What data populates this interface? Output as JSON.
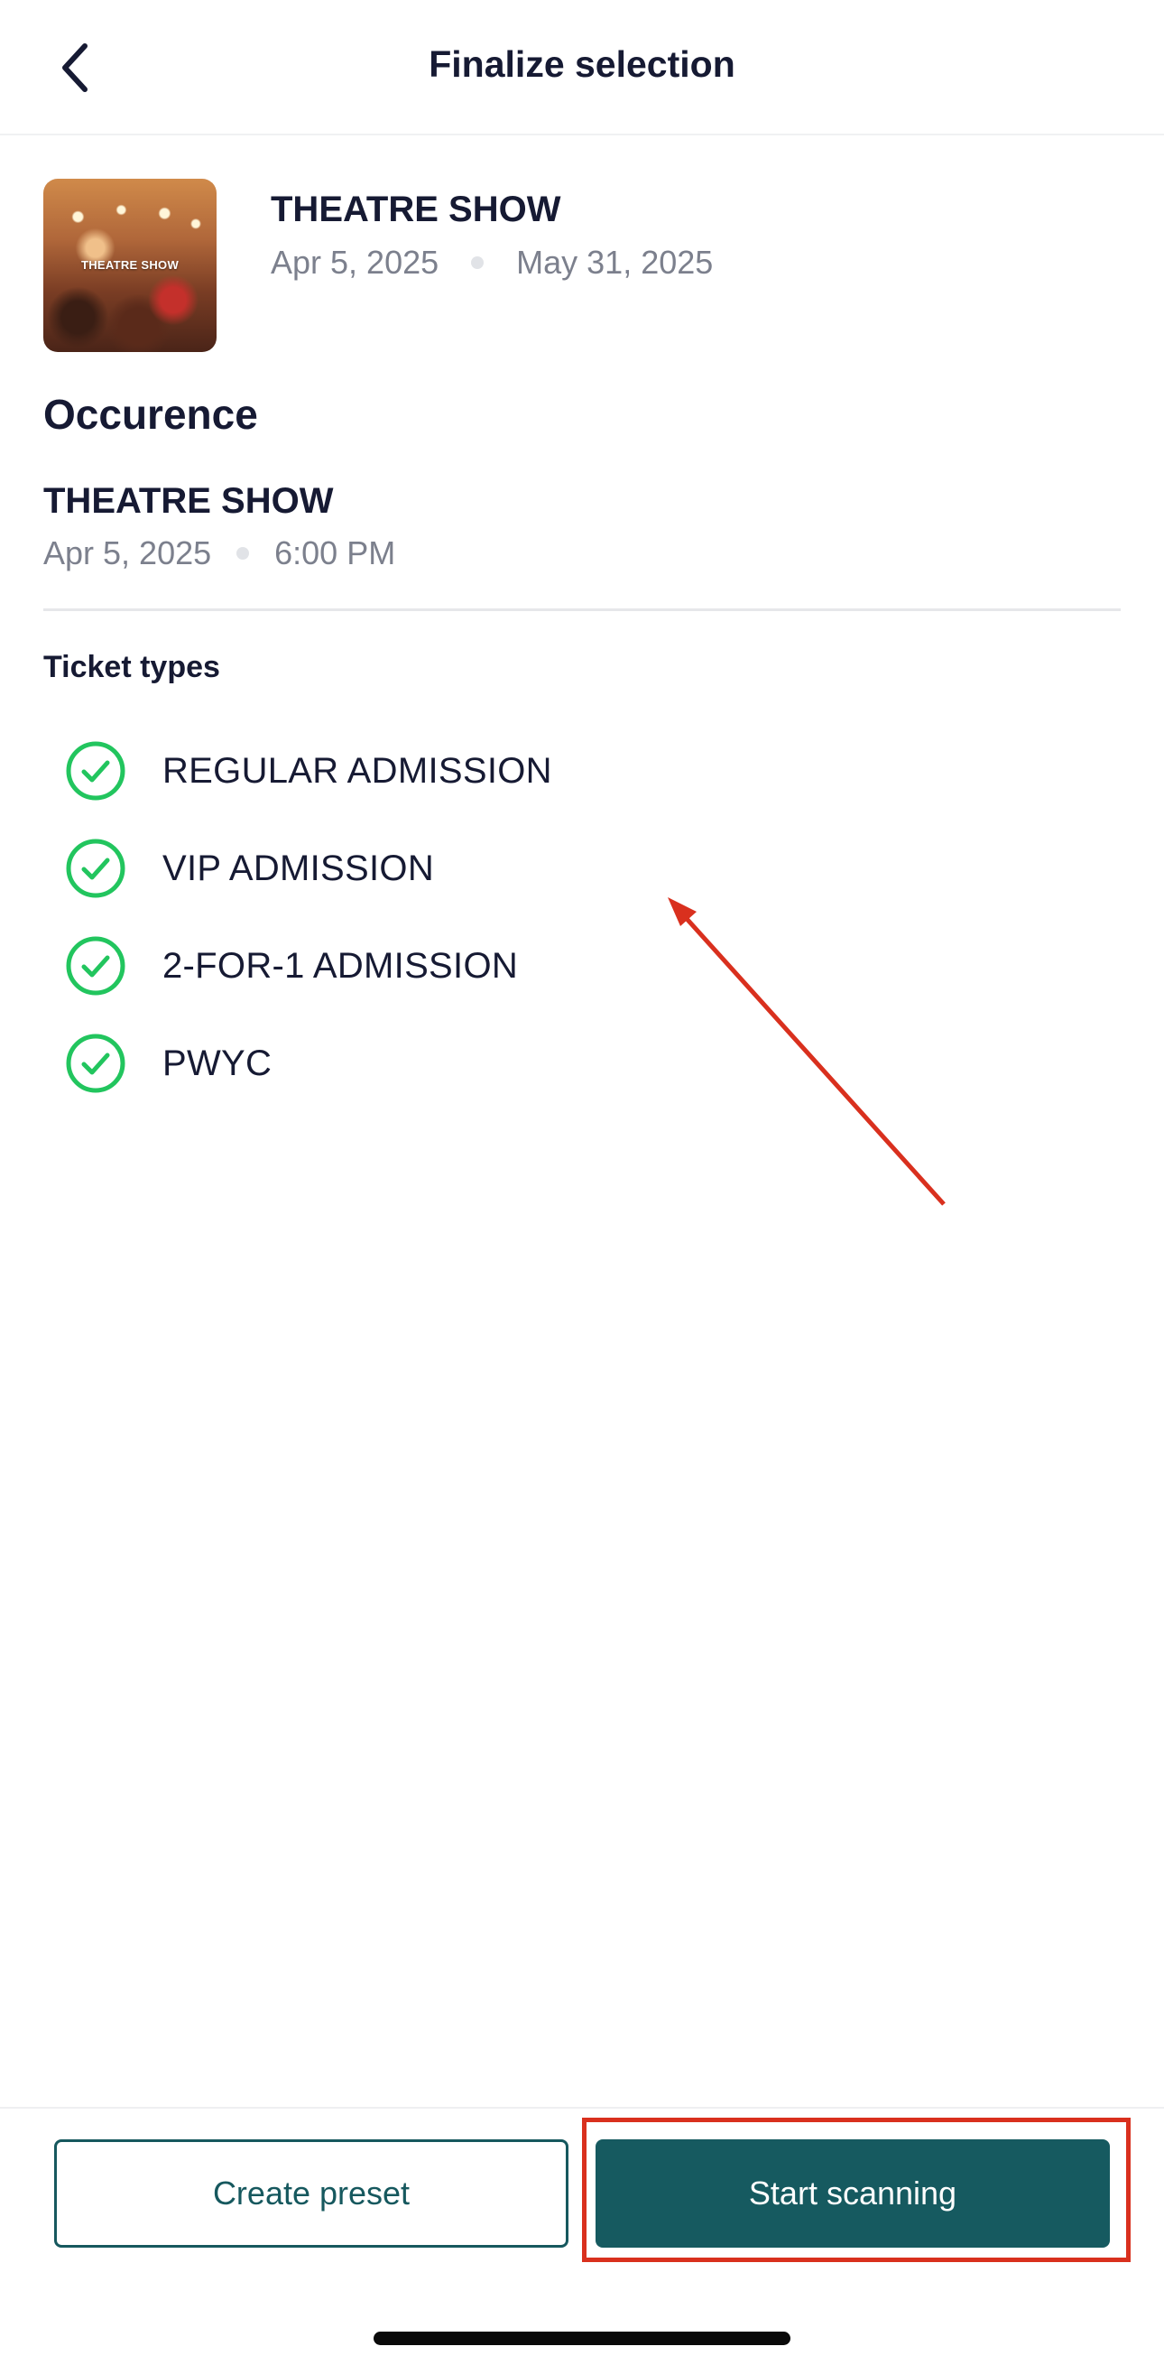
{
  "header": {
    "title": "Finalize selection"
  },
  "event": {
    "thumbnail_text": "THEATRE SHOW",
    "name": "THEATRE SHOW",
    "start_date": "Apr 5, 2025",
    "end_date": "May 31, 2025"
  },
  "occurrence": {
    "heading": "Occurence",
    "name": "THEATRE SHOW",
    "date": "Apr 5, 2025",
    "time": "6:00 PM"
  },
  "ticket_types": {
    "heading": "Ticket types",
    "items": [
      {
        "label": "REGULAR ADMISSION",
        "checked": true
      },
      {
        "label": "VIP ADMISSION",
        "checked": true
      },
      {
        "label": "2-FOR-1 ADMISSION",
        "checked": true
      },
      {
        "label": "PWYC",
        "checked": true
      }
    ]
  },
  "footer": {
    "create_preset_label": "Create preset",
    "start_scanning_label": "Start scanning"
  },
  "colors": {
    "primary": "#165a60",
    "check_green": "#22c55e",
    "annotation_red": "#d9301e",
    "text_dark": "#161a33",
    "text_muted": "#7c808d"
  },
  "icons": {
    "back": "chevron-left-icon",
    "check": "check-circle-icon"
  }
}
